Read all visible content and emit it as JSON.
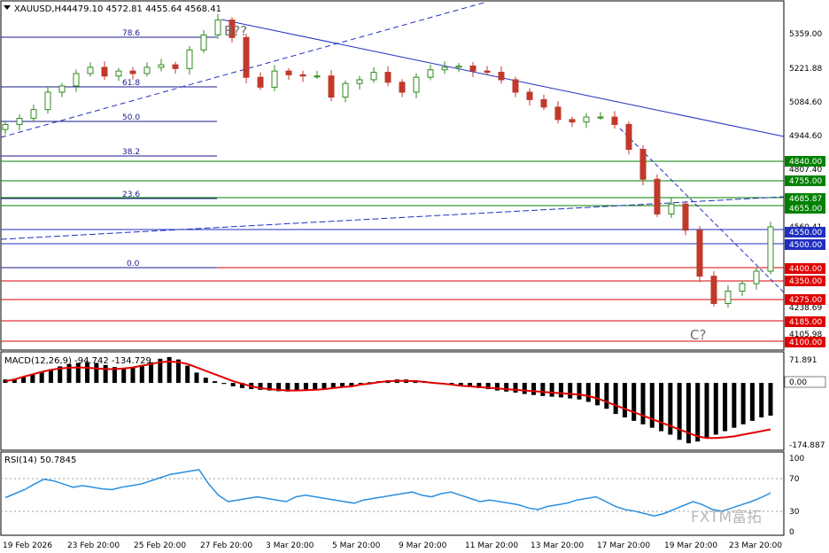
{
  "header": {
    "symbol": "XAUUSD,H4",
    "ohlc": "4479.10 4572.81 4455.64 4568.41"
  },
  "annotations": {
    "wave_b": "B??",
    "wave_c": "C?",
    "watermark": "FXTM富拓"
  },
  "colors": {
    "bull": "#2e8b1e",
    "bear": "#c0392b",
    "candle_fill_bull": "#ffffff",
    "trend": "#1f2fc0",
    "support": "#e00000",
    "resistance": "#008000",
    "macd_signal": "#e00000",
    "rsi": "#2a8fe0"
  },
  "chart_data": [
    {
      "type": "candlestick",
      "title": "XAUUSD,H4",
      "ylim": [
        4080,
        5470
      ],
      "x_ticks": [
        "19 Feb 2026",
        "23 Feb 20:00",
        "25 Feb 20:00",
        "27 Feb 20:00",
        "3 Mar 20:00",
        "5 Mar 20:00",
        "9 Mar 20:00",
        "11 Mar 20:00",
        "13 Mar 20:00",
        "17 Mar 20:00",
        "19 Mar 20:00",
        "23 Mar 20:00"
      ],
      "y_ticks": [
        5359.0,
        5221.88,
        5084.6,
        4944.6,
        4807.4,
        4560.41,
        4238.69,
        4105.98
      ],
      "last_price": 4568.41,
      "close_path": [
        4980,
        5005,
        5040,
        5110,
        5135,
        5185,
        5210,
        5175,
        5195,
        5185,
        5210,
        5220,
        5205,
        5280,
        5340,
        5400,
        5330,
        5170,
        5130,
        5195,
        5180,
        5175,
        5175,
        5090,
        5145,
        5160,
        5190,
        5150,
        5110,
        5170,
        5200,
        5210,
        5215,
        5195,
        5190,
        5160,
        5110,
        5080,
        5050,
        5000,
        4990,
        5010,
        5010,
        4980,
        4880,
        4760,
        4620,
        4660,
        4555,
        4370,
        4260,
        4310,
        4340,
        4390,
        4568.41
      ],
      "resistance_levels": [
        4840.0,
        4755.0,
        4685.87,
        4655.0
      ],
      "pivot_levels": [
        4550.0,
        4500.0
      ],
      "support_levels": [
        4400.0,
        4350.0,
        4275.0,
        4185.0,
        4100.0
      ],
      "fibonacci": [
        {
          "label": "78.6",
          "value": 5360
        },
        {
          "label": "61.8",
          "value": 5210
        },
        {
          "label": "50.0",
          "value": 5075
        },
        {
          "label": "38.2",
          "value": 4935
        },
        {
          "label": "23.6",
          "value": 4695
        },
        {
          "label": "0.0",
          "value": 4410
        }
      ]
    },
    {
      "type": "bar",
      "title": "MACD(12,26,9) -94.742 -134.729",
      "ylim": [
        -190,
        85
      ],
      "y_ticks": [
        71.891,
        0.0,
        -174.887
      ],
      "histogram": [
        10,
        12,
        18,
        25,
        32,
        40,
        48,
        55,
        58,
        60,
        58,
        52,
        46,
        42,
        46,
        52,
        60,
        70,
        75,
        68,
        50,
        30,
        15,
        5,
        -3,
        -10,
        -15,
        -18,
        -20,
        -22,
        -24,
        -25,
        -24,
        -22,
        -20,
        -18,
        -15,
        -12,
        -8,
        -3,
        2,
        5,
        8,
        10,
        10,
        8,
        5,
        2,
        -2,
        -5,
        -8,
        -12,
        -15,
        -18,
        -22,
        -25,
        -28,
        -32,
        -35,
        -38,
        -40,
        -42,
        -45,
        -48,
        -55,
        -65,
        -75,
        -90,
        -100,
        -110,
        -120,
        -130,
        -140,
        -150,
        -165,
        -175,
        -170,
        -160,
        -150,
        -140,
        -130,
        -120,
        -110,
        -100,
        -95
      ],
      "signal": [
        5,
        10,
        18,
        25,
        32,
        38,
        42,
        44,
        45,
        44,
        42,
        40,
        40,
        42,
        45,
        50,
        55,
        60,
        62,
        60,
        55,
        45,
        35,
        25,
        15,
        5,
        -2,
        -10,
        -15,
        -18,
        -20,
        -22,
        -22,
        -21,
        -20,
        -18,
        -15,
        -12,
        -10,
        -5,
        -2,
        2,
        5,
        6,
        6,
        5,
        3,
        0,
        -2,
        -5,
        -8,
        -10,
        -12,
        -14,
        -16,
        -18,
        -20,
        -22,
        -24,
        -26,
        -28,
        -30,
        -32,
        -34,
        -38,
        -45,
        -55,
        -65,
        -75,
        -85,
        -95,
        -105,
        -115,
        -125,
        -135,
        -145,
        -155,
        -160,
        -160,
        -158,
        -155,
        -150,
        -145,
        -140,
        -134.729
      ]
    },
    {
      "type": "line",
      "title": "RSI(14) 50.7845",
      "ylim": [
        0,
        100
      ],
      "y_ticks": [
        100,
        70,
        30,
        0
      ],
      "levels": [
        70,
        30
      ],
      "last_value": 50.7845,
      "values": [
        45,
        50,
        55,
        62,
        68,
        66,
        62,
        58,
        60,
        58,
        56,
        55,
        58,
        60,
        62,
        66,
        70,
        74,
        76,
        78,
        80,
        62,
        48,
        40,
        42,
        44,
        46,
        44,
        42,
        40,
        46,
        48,
        46,
        44,
        42,
        40,
        38,
        42,
        44,
        46,
        48,
        50,
        52,
        48,
        46,
        50,
        52,
        48,
        44,
        40,
        42,
        40,
        38,
        36,
        32,
        30,
        34,
        36,
        38,
        42,
        44,
        46,
        40,
        34,
        30,
        28,
        25,
        22,
        25,
        30,
        35,
        40,
        36,
        30,
        28,
        32,
        36,
        40,
        45,
        50.7845
      ]
    }
  ],
  "price_labels": [
    "5359.00",
    "5221.88",
    "5084.60",
    "4944.60",
    "4840.00",
    "4807.40",
    "4755.00",
    "4685.87",
    "4655.00",
    "4560.41",
    "4550.00",
    "4500.00",
    "4400.00",
    "4350.00",
    "4275.00",
    "4238.69",
    "4185.00",
    "4105.98",
    "4100.00"
  ],
  "macd_labels": [
    "71.891",
    "0.00",
    "-174.887"
  ],
  "rsi_labels": [
    "100",
    "70",
    "30",
    "0"
  ]
}
